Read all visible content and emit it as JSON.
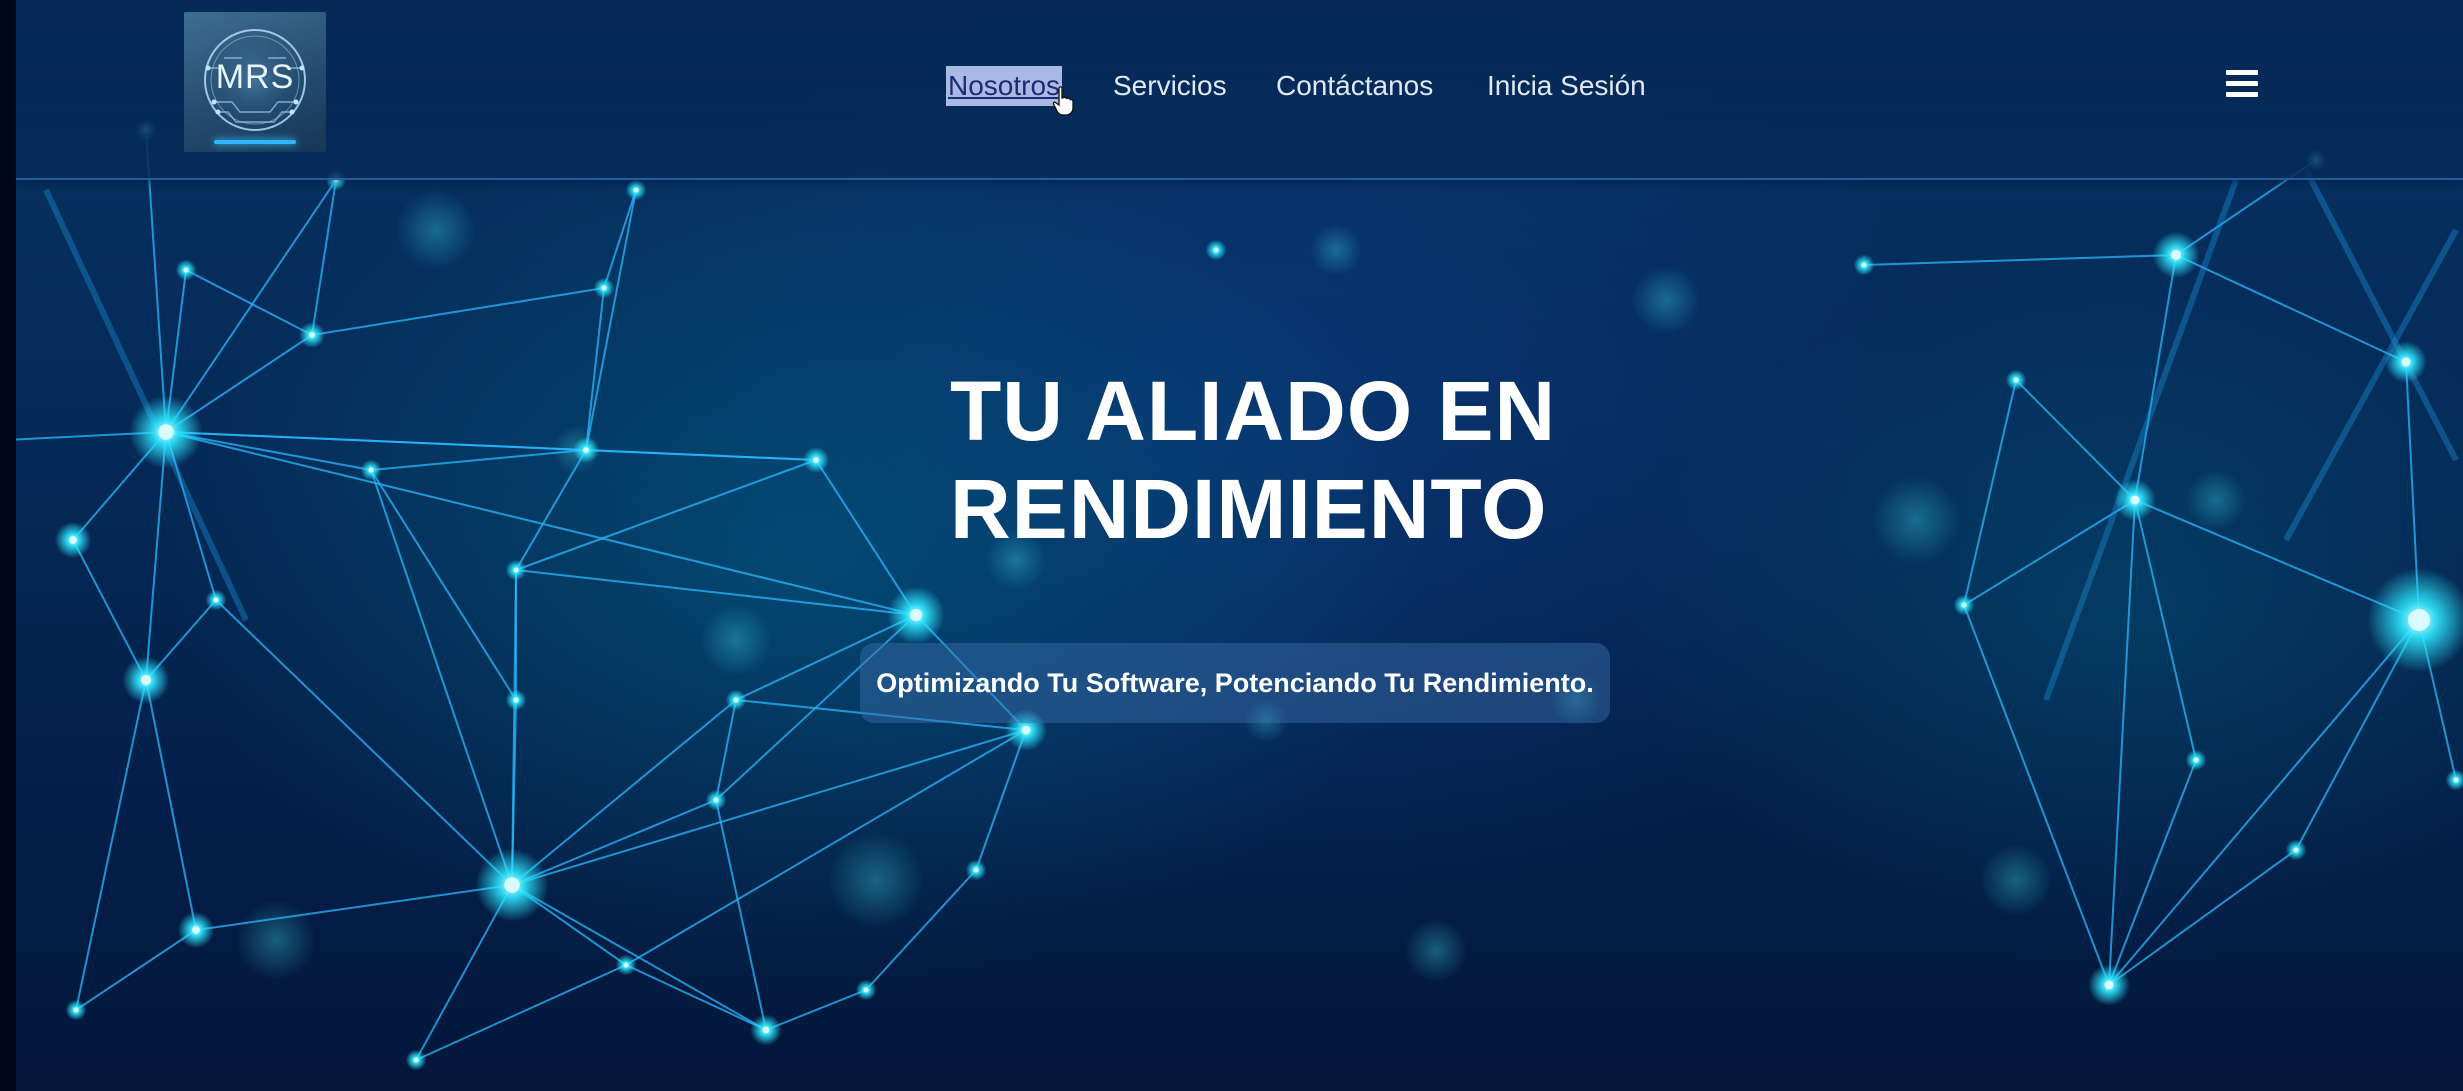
{
  "header": {
    "logo_text": "MRS",
    "nav": [
      {
        "label": "Nosotros",
        "selected": true
      },
      {
        "label": "Servicios",
        "selected": false
      },
      {
        "label": "Contáctanos",
        "selected": false
      },
      {
        "label": "Inicia Sesión",
        "selected": false
      }
    ],
    "menu_icon": "hamburger-menu-icon"
  },
  "hero": {
    "title_line1": "TU ALIADO EN",
    "title_line2": "RENDIMIENTO",
    "subtitle": "Optimizando Tu Software, Potenciando Tu Rendimiento."
  },
  "colors": {
    "header_bg": "#06285a",
    "accent_cyan": "#2de6ff",
    "text": "#ffffff",
    "selection": "#a9b9e6"
  }
}
